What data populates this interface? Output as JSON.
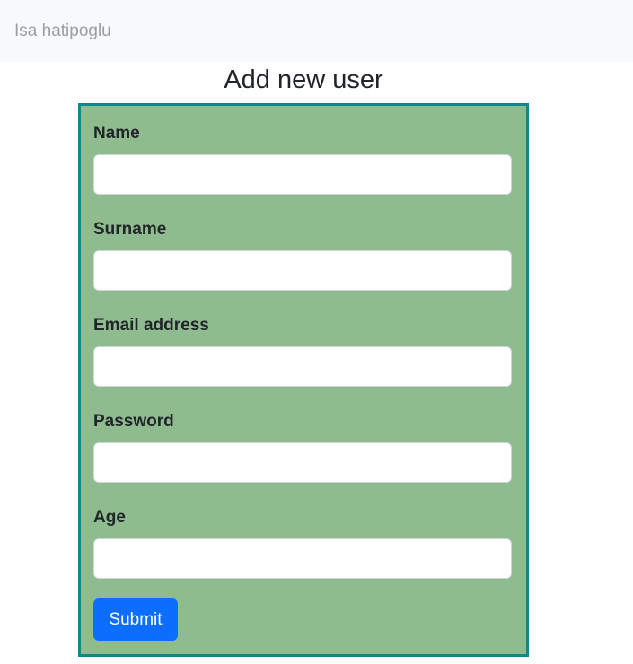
{
  "navbar": {
    "brand": "Isa hatipoglu"
  },
  "page": {
    "title": "Add new user"
  },
  "form": {
    "fields": [
      {
        "label": "Name",
        "value": "",
        "placeholder": ""
      },
      {
        "label": "Surname",
        "value": "",
        "placeholder": ""
      },
      {
        "label": "Email address",
        "value": "",
        "placeholder": ""
      },
      {
        "label": "Password",
        "value": "",
        "placeholder": ""
      },
      {
        "label": "Age",
        "value": "",
        "placeholder": ""
      }
    ],
    "submit_label": "Submit"
  },
  "colors": {
    "card_background": "#8fbc8f",
    "card_border": "#10898a",
    "navbar_background": "#f8f9fa",
    "button_primary": "#0d6efd"
  }
}
